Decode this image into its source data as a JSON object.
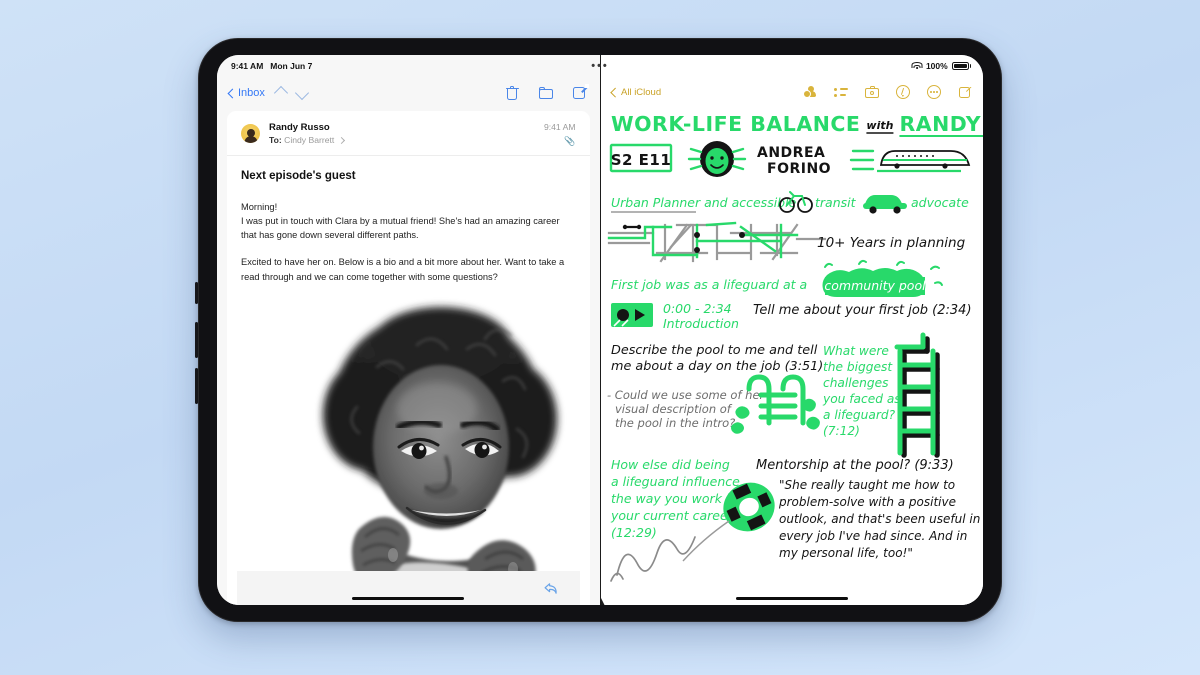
{
  "status_bar": {
    "time": "9:41 AM",
    "date": "Mon Jun 7",
    "multitask_dots": "•••",
    "wifi_icon": "wifi-icon",
    "battery_percent": "100%",
    "battery_icon": "battery-full-icon"
  },
  "mail": {
    "toolbar": {
      "back_label": "Inbox",
      "back_icon": "chevron-left-icon",
      "prev_icon": "chevron-up-icon",
      "next_icon": "chevron-down-icon",
      "trash_icon": "trash-icon",
      "folder_icon": "folder-icon",
      "compose_icon": "compose-icon",
      "accent_color": "#3478f6"
    },
    "message": {
      "sender": "Randy Russo",
      "to_label": "To:",
      "recipient": "Cindy Barrett",
      "time": "9:41 AM",
      "attachment_icon": "paperclip-icon",
      "avatar_icon": "avatar",
      "subject": "Next episode's guest",
      "paragraphs": [
        "Morning!\nI was put in touch with Clara by a mutual friend! She's had an amazing career that has gone down several different paths.",
        "Excited to have her on. Below is a bio and a bit more about her. Want to take a read through and we can come together with some questions?"
      ],
      "photo_caption": "black-and-white portrait photograph of a smiling woman resting her chin on her hands"
    },
    "bottom_bar": {
      "reply_icon": "reply-arrow-icon"
    }
  },
  "notes": {
    "toolbar": {
      "back_label": "All iCloud",
      "back_icon": "chevron-left-icon",
      "collaborate_icon": "collaborate-icon",
      "checklist_icon": "checklist-icon",
      "camera_icon": "camera-icon",
      "markup_icon": "markup-pen-icon",
      "more_icon": "more-ellipsis-icon",
      "new_note_icon": "new-note-icon",
      "accent_color": "#d9b43c"
    },
    "handwritten_note": {
      "accent_green": "#28d96a",
      "ink_black": "#141414",
      "title": "WORK-LIFE BALANCE",
      "title_with": "with",
      "title_host": "RANDY RUSSO",
      "episode_badge": "S2 E11",
      "guest_name_line1": "ANDREA",
      "guest_name_line2": "FORINO",
      "face_doodle": "guest-face-doodle",
      "bus_doodle": "bus-doodle",
      "tagline_before": "Urban Planner and accessible",
      "bike_doodle": "bicycle-doodle",
      "tagline_middle": "transit",
      "car_doodle": "car-doodle",
      "tagline_after": "advocate",
      "map_doodle": "transit-map-doodle",
      "experience": "10+ Years in planning",
      "first_job_line": "First job was as a lifeguard at a",
      "first_job_highlight": "community pool",
      "film_icon": "film-strip-doodle",
      "chapter_time": "0:00 - 2:34",
      "chapter_label": "Introduction",
      "question_1": "Tell me about your first job (2:34)",
      "question_2_line1": "Describe the pool to me and tell",
      "question_2_line2": "me about a day on the job (3:51)",
      "subnote_line1": "- Could we use some of her",
      "subnote_line2": "visual description of",
      "subnote_line3": "the pool in the intro?",
      "pool_ladder_doodle": "pool-ladder-doodle",
      "question_3_lines": [
        "What were",
        "the biggest",
        "challenges",
        "you faced as",
        "a lifeguard?",
        "(7:12)"
      ],
      "lifeguard_chair_doodle": "lifeguard-chair-doodle",
      "question_4_lines": [
        "How else did being",
        "a lifeguard influence",
        "the way you work in",
        "your current career?",
        "(12:29)"
      ],
      "question_5": "Mentorship at the pool? (9:33)",
      "life_ring_doodle": "life-ring-doodle",
      "quote_lines": [
        "\"She really taught me how to",
        "problem-solve with a positive",
        "outlook, and that's been useful in",
        "every job I've had since. And in",
        "my personal life, too!\""
      ],
      "squiggle_doodle": "squiggle-doodle"
    }
  },
  "device": {
    "home_indicator_left": "home-indicator",
    "home_indicator_right": "home-indicator"
  }
}
